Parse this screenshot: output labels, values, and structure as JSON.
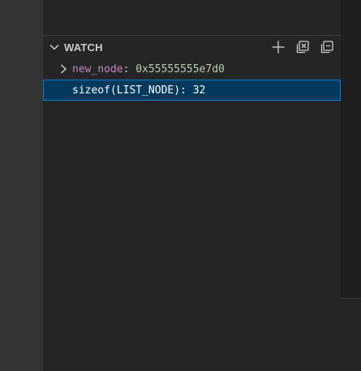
{
  "watch": {
    "title": "WATCH",
    "actions": [
      {
        "name": "add-expression",
        "icon": "plus-icon"
      },
      {
        "name": "refresh-all",
        "icon": "refresh-icon"
      },
      {
        "name": "collapse-all",
        "icon": "collapse-all-icon"
      }
    ],
    "items": [
      {
        "name": "new_node",
        "separator": ": ",
        "value": "0x55555555e7d0",
        "expandable": true
      },
      {
        "expression": "sizeof(LIST_NODE): 32",
        "selected": true
      }
    ]
  },
  "colors": {
    "accent": "#007fd4",
    "selection": "#04395e",
    "variable_name": "#c586c0",
    "value": "#b5cea8"
  }
}
